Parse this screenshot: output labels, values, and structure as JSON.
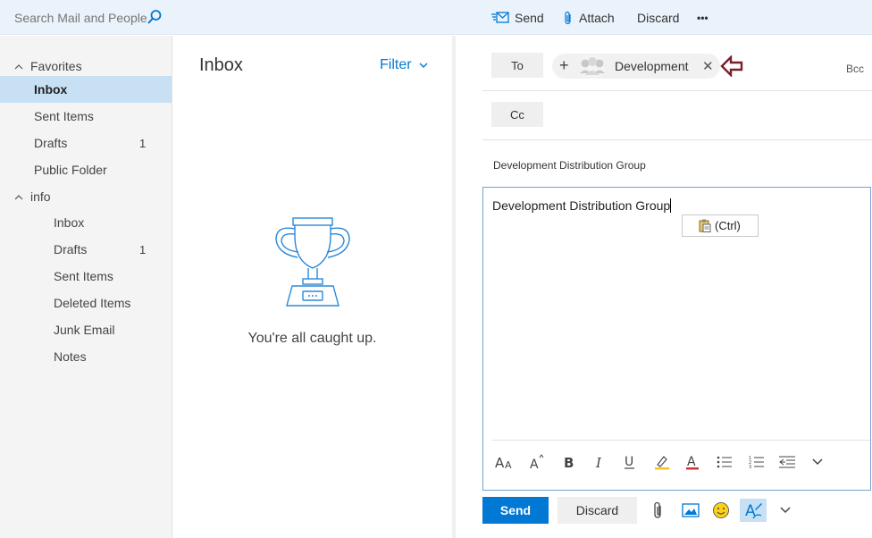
{
  "search": {
    "placeholder": "Search Mail and People"
  },
  "toolbar": {
    "send": "Send",
    "attach": "Attach",
    "discard": "Discard",
    "more": "•••"
  },
  "nav": {
    "favorites_label": "Favorites",
    "favorites": [
      {
        "label": "Inbox",
        "count": "",
        "selected": true
      },
      {
        "label": "Sent Items",
        "count": ""
      },
      {
        "label": "Drafts",
        "count": "1"
      },
      {
        "label": "Public Folder",
        "count": ""
      }
    ],
    "account_label": "info",
    "account": [
      {
        "label": "Inbox",
        "count": ""
      },
      {
        "label": "Drafts",
        "count": "1"
      },
      {
        "label": "Sent Items",
        "count": ""
      },
      {
        "label": "Deleted Items",
        "count": ""
      },
      {
        "label": "Junk Email",
        "count": ""
      },
      {
        "label": "Notes",
        "count": ""
      }
    ]
  },
  "list": {
    "title": "Inbox",
    "filter": "Filter",
    "empty_message": "You're all caught up."
  },
  "compose": {
    "to_label": "To",
    "cc_label": "Cc",
    "bcc_label": "Bcc",
    "recipient": "Development",
    "subject": "Development Distribution Group",
    "body": "Development Distribution Group",
    "paste_option": "(Ctrl)",
    "send": "Send",
    "discard": "Discard"
  },
  "colors": {
    "accent": "#0078d4",
    "selected_nav": "#c7e0f4",
    "topbar": "#eaf3fb",
    "arrow": "#7a1f2b"
  },
  "icons": {
    "format_bar": [
      "font-size-icon",
      "grow-font-icon",
      "bold-icon",
      "italic-icon",
      "underline-icon",
      "highlight-icon",
      "font-color-icon",
      "bullets-icon",
      "numbering-icon",
      "decrease-indent-icon",
      "more-options-chevron-icon"
    ],
    "bottom_bar": [
      "paperclip-icon",
      "picture-icon",
      "emoji-icon",
      "format-text-icon",
      "chevron-down-icon"
    ]
  }
}
